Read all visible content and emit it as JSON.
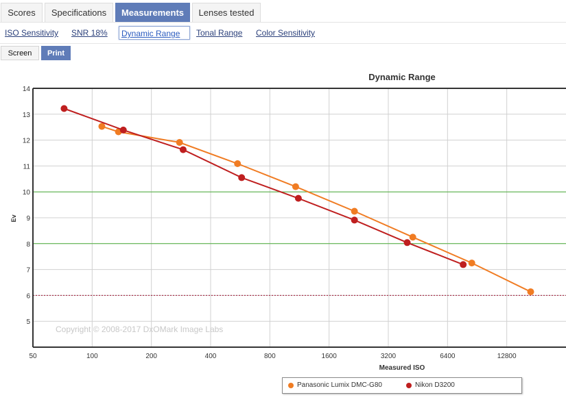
{
  "tabs": [
    {
      "label": "Scores"
    },
    {
      "label": "Specifications"
    },
    {
      "label": "Measurements"
    },
    {
      "label": "Lenses tested"
    }
  ],
  "active_tab": "Measurements",
  "subnav": [
    {
      "label": "ISO Sensitivity"
    },
    {
      "label": "SNR 18%"
    },
    {
      "label": "Dynamic Range"
    },
    {
      "label": "Tonal Range"
    },
    {
      "label": "Color Sensitivity"
    }
  ],
  "active_subnav": "Dynamic Range",
  "view_buttons": {
    "screen": "Screen",
    "print": "Print"
  },
  "colors": {
    "accent": "#5f7cb8",
    "series_orange": "#f07c23",
    "series_red": "#bf1f1f",
    "green_line": "#4caf3a",
    "red_line": "#9e1030"
  },
  "chart_data": {
    "type": "line",
    "title": "Dynamic Range",
    "xlabel": "Measured ISO",
    "ylabel": "Ev",
    "x_scale": "log2",
    "xlim": [
      50,
      25600
    ],
    "ylim": [
      4,
      14
    ],
    "x_ticks": [
      50,
      100,
      200,
      400,
      800,
      1600,
      3200,
      6400,
      12800
    ],
    "y_ticks": [
      5,
      6,
      7,
      8,
      9,
      10,
      11,
      12,
      13,
      14
    ],
    "grid": true,
    "reference_lines": [
      {
        "y": 10,
        "style": "solid",
        "color": "green"
      },
      {
        "y": 8,
        "style": "solid",
        "color": "green"
      },
      {
        "y": 6,
        "style": "dotted",
        "color": "red"
      }
    ],
    "watermark": "Copyright © 2008-2017 DxOMark Image Labs",
    "legend_position": "bottom-right",
    "series": [
      {
        "name": "Panasonic Lumix DMC-G80",
        "color": "#f07c23",
        "points": [
          {
            "x": 112,
            "y": 12.53
          },
          {
            "x": 136,
            "y": 12.32
          },
          {
            "x": 278,
            "y": 11.91
          },
          {
            "x": 548,
            "y": 11.09
          },
          {
            "x": 1082,
            "y": 10.2
          },
          {
            "x": 2153,
            "y": 9.25
          },
          {
            "x": 4262,
            "y": 8.25
          },
          {
            "x": 8500,
            "y": 7.25
          },
          {
            "x": 16929,
            "y": 6.14
          }
        ]
      },
      {
        "name": "Nikon D3200",
        "color": "#bf1f1f",
        "points": [
          {
            "x": 72,
            "y": 13.22
          },
          {
            "x": 144,
            "y": 12.39
          },
          {
            "x": 290,
            "y": 11.63
          },
          {
            "x": 575,
            "y": 10.55
          },
          {
            "x": 1117,
            "y": 9.75
          },
          {
            "x": 2153,
            "y": 8.91
          },
          {
            "x": 3991,
            "y": 8.04
          },
          {
            "x": 7687,
            "y": 7.19
          }
        ]
      }
    ]
  }
}
